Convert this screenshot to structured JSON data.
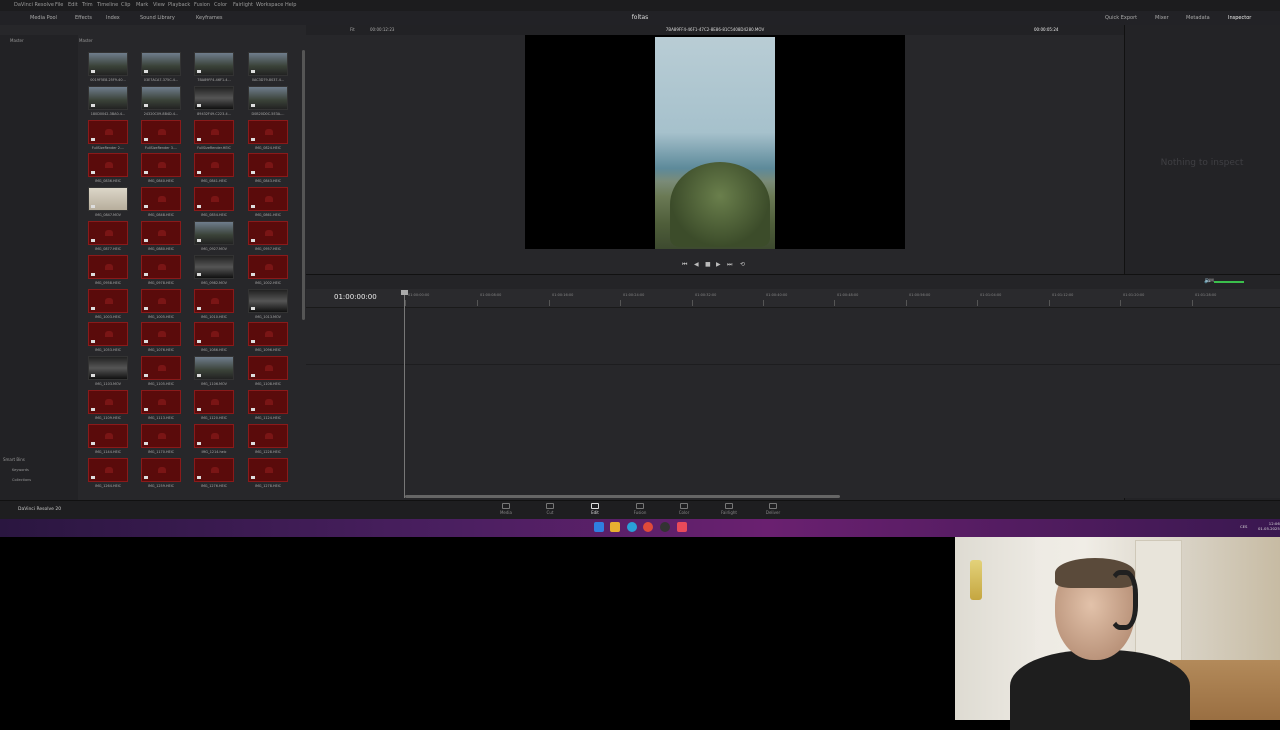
{
  "menu": [
    "DaVinci Resolve",
    "File",
    "Edit",
    "Trim",
    "Timeline",
    "Clip",
    "Mark",
    "View",
    "Playback",
    "Fusion",
    "Color",
    "Fairlight",
    "Workspace",
    "Help"
  ],
  "toolbar": {
    "media_pool": "Media Pool",
    "effects": "Effects",
    "index": "Index",
    "sound_library": "Sound Library",
    "keyframes": "Keyframes",
    "project_title": "foltas",
    "quick_export": "Quick Export",
    "mixer": "Mixer",
    "metadata": "Metadata",
    "inspector": "Inspector"
  },
  "pool": {
    "bin_label": "Master",
    "header_label": "Master",
    "thumbnails": [
      {
        "name": "0019F5E8-25F9-40...",
        "kind": "photo"
      },
      {
        "name": "03E7ACA7-375C-4...",
        "kind": "photo"
      },
      {
        "name": "7BA89FF4-46F1-4...",
        "kind": "photo"
      },
      {
        "name": "0AC3D79-8037-4...",
        "kind": "photo"
      },
      {
        "name": "180D0042-3BA0-4...",
        "kind": "photo"
      },
      {
        "name": "24320C09-8B4D-4...",
        "kind": "photo"
      },
      {
        "name": "89432F49-C223-4...",
        "kind": "dark"
      },
      {
        "name": "D0B20D0C-5E3A-...",
        "kind": "photo"
      },
      {
        "name": "FullSizeRender 2....",
        "kind": "red"
      },
      {
        "name": "FullSizeRender 3....",
        "kind": "red"
      },
      {
        "name": "FullSizeRender.HEIC",
        "kind": "red"
      },
      {
        "name": "IMG_0824.HEIC",
        "kind": "red"
      },
      {
        "name": "IMG_0836.HEIC",
        "kind": "red"
      },
      {
        "name": "IMG_0840.HEIC",
        "kind": "red"
      },
      {
        "name": "IMG_0841.HEIC",
        "kind": "red"
      },
      {
        "name": "IMG_0843.HEIC",
        "kind": "red"
      },
      {
        "name": "IMG_0847.MOV",
        "kind": "light"
      },
      {
        "name": "IMG_0848.HEIC",
        "kind": "red"
      },
      {
        "name": "IMG_0854.HEIC",
        "kind": "red"
      },
      {
        "name": "IMG_0861.HEIC",
        "kind": "red"
      },
      {
        "name": "IMG_0877.HEIC",
        "kind": "red"
      },
      {
        "name": "IMG_0880.HEIC",
        "kind": "red"
      },
      {
        "name": "IMG_0927.MOV",
        "kind": "photo"
      },
      {
        "name": "IMG_0957.HEIC",
        "kind": "red"
      },
      {
        "name": "IMG_0958.HEIC",
        "kind": "red"
      },
      {
        "name": "IMG_0978.HEIC",
        "kind": "red"
      },
      {
        "name": "IMG_0982.MOV",
        "kind": "dark"
      },
      {
        "name": "IMG_1002.HEIC",
        "kind": "red"
      },
      {
        "name": "IMG_1003.HEIC",
        "kind": "red"
      },
      {
        "name": "IMG_1005.HEIC",
        "kind": "red"
      },
      {
        "name": "IMG_1010.HEIC",
        "kind": "red"
      },
      {
        "name": "IMG_1013.MOV",
        "kind": "dark"
      },
      {
        "name": "IMG_1053.HEIC",
        "kind": "red"
      },
      {
        "name": "IMG_1076.HEIC",
        "kind": "red"
      },
      {
        "name": "IMG_1086.HEIC",
        "kind": "red"
      },
      {
        "name": "IMG_1096.HEIC",
        "kind": "red"
      },
      {
        "name": "IMG_1103.MOV",
        "kind": "dark"
      },
      {
        "name": "IMG_1105.HEIC",
        "kind": "red"
      },
      {
        "name": "IMG_1106.MOV",
        "kind": "photo"
      },
      {
        "name": "IMG_1108.HEIC",
        "kind": "red"
      },
      {
        "name": "IMG_1109.HEIC",
        "kind": "red"
      },
      {
        "name": "IMG_1113.HEIC",
        "kind": "red"
      },
      {
        "name": "IMG_1120.HEIC",
        "kind": "red"
      },
      {
        "name": "IMG_1124.HEIC",
        "kind": "red"
      },
      {
        "name": "IMG_1144.HEIC",
        "kind": "red"
      },
      {
        "name": "IMG_1170.HEIC",
        "kind": "red"
      },
      {
        "name": "IMG_1214.heic",
        "kind": "red"
      },
      {
        "name": "IMG_1228.HEIC",
        "kind": "red"
      },
      {
        "name": "IMG_1264.HEIC",
        "kind": "red"
      },
      {
        "name": "IMG_1259.HEIC",
        "kind": "red"
      },
      {
        "name": "IMG_1276.HEIC",
        "kind": "red"
      },
      {
        "name": "IMG_1278.HEIC",
        "kind": "red"
      }
    ],
    "smart_bins": "Smart Bins",
    "keywords": "Keywords",
    "collections": "Collections"
  },
  "viewer": {
    "fit": "Fit",
    "source_timecode": "00:00:12:23",
    "clip_name": "7BA89FF4-46F1-47C2-8E86-81C5408D4280.MOV",
    "duration_timecode": "00:00:05:24",
    "nothing_to_inspect": "Nothing to inspect"
  },
  "timeline": {
    "timecode": "01:00:00:00",
    "ticks": [
      "01:00:00:00",
      "01:00:08:00",
      "01:00:16:00",
      "01:00:24:00",
      "01:00:32:00",
      "01:00:40:00",
      "01:00:48:00",
      "01:00:56:00",
      "01:01:04:00",
      "01:01:12:00",
      "01:01:20:00",
      "01:01:28:00"
    ],
    "volume_label": "DIM"
  },
  "pages": [
    {
      "label": "Media",
      "active": false
    },
    {
      "label": "Cut",
      "active": false
    },
    {
      "label": "Edit",
      "active": true
    },
    {
      "label": "Fusion",
      "active": false
    },
    {
      "label": "Color",
      "active": false
    },
    {
      "label": "Fairlight",
      "active": false
    },
    {
      "label": "Deliver",
      "active": false
    }
  ],
  "app_name": "DaVinci Resolve 20",
  "taskbar": {
    "lang": "CES",
    "time": "12:06",
    "date": "01.05.2025",
    "icons": [
      "start-icon",
      "file-explorer-icon",
      "edge-icon",
      "chrome-icon",
      "resolve-icon",
      "app-icon"
    ]
  },
  "colors": {
    "accent_red": "#8a1a1a",
    "taskbar_purple": "#4a1f60",
    "volume_green": "#3bbf4c"
  }
}
